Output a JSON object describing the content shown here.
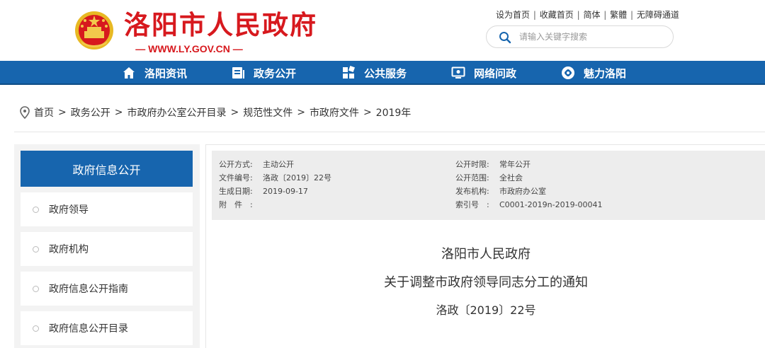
{
  "header": {
    "site_title": "洛阳市人民政府",
    "site_url": "— WWW.LY.GOV.CN —",
    "top_links": [
      "设为首页",
      "收藏首页",
      "简体",
      "繁體",
      "无障碍通道"
    ],
    "search_placeholder": "请输入关键字搜索"
  },
  "nav": {
    "items": [
      {
        "label": "洛阳资讯",
        "icon": "home-icon"
      },
      {
        "label": "政务公开",
        "icon": "document-icon"
      },
      {
        "label": "公共服务",
        "icon": "grid-icon"
      },
      {
        "label": "网络问政",
        "icon": "monitor-icon"
      },
      {
        "label": "魅力洛阳",
        "icon": "flower-icon"
      }
    ]
  },
  "breadcrumb": [
    "首页",
    "政务公开",
    "市政府办公室公开目录",
    "规范性文件",
    "市政府文件",
    "2019年"
  ],
  "sidebar": {
    "title": "政府信息公开",
    "items": [
      {
        "label": "政府领导"
      },
      {
        "label": "政府机构"
      },
      {
        "label": "政府信息公开指南"
      },
      {
        "label": "政府信息公开目录"
      }
    ]
  },
  "meta": {
    "left": [
      {
        "label": "公开方式:",
        "value": "主动公开"
      },
      {
        "label": "文件编号:",
        "value": "洛政〔2019〕22号"
      },
      {
        "label": "生成日期:",
        "value": "2019-09-17"
      },
      {
        "label": "附　件　:",
        "value": ""
      }
    ],
    "right": [
      {
        "label": "公开时限:",
        "value": "常年公开"
      },
      {
        "label": "公开范围:",
        "value": "全社会"
      },
      {
        "label": "发布机构:",
        "value": "市政府办公室"
      },
      {
        "label": "索引号　:",
        "value": "C0001-2019n-2019-00041"
      }
    ]
  },
  "document": {
    "title_line1": "洛阳市人民政府",
    "title_line2": "关于调整市政府领导同志分工的通知",
    "number": "洛政〔2019〕22号"
  },
  "colors": {
    "brand_red": "#d7191e",
    "nav_blue": "#1765ae"
  }
}
